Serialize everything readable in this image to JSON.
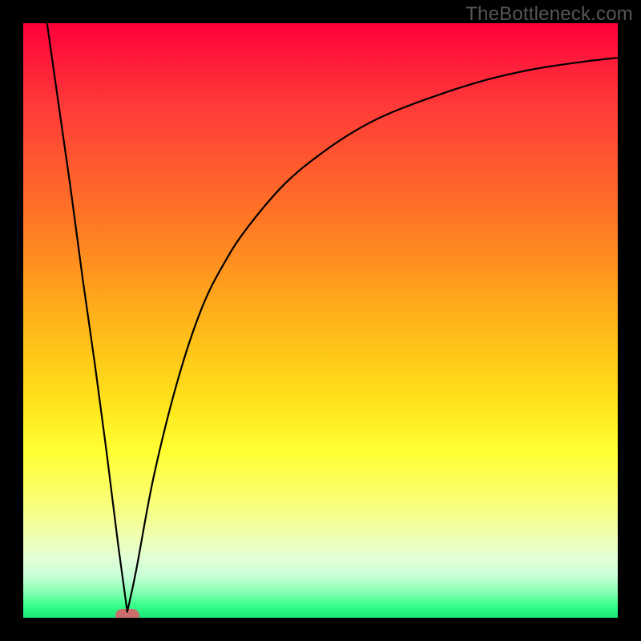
{
  "watermark": "TheBottleneck.com",
  "colors": {
    "frame": "#000000",
    "pill": "#cb6f6d",
    "curve": "#000000"
  },
  "chart_data": {
    "type": "line",
    "title": "",
    "xlabel": "",
    "ylabel": "",
    "xlim": [
      0,
      100
    ],
    "ylim": [
      0,
      100
    ],
    "grid": false,
    "legend": false,
    "annotations": [
      {
        "name": "marker-pill",
        "x": 17.5,
        "y": 0,
        "color": "#cb6f6d"
      }
    ],
    "series": [
      {
        "name": "bottleneck-curve",
        "x": [
          4,
          6,
          8,
          10,
          12,
          14,
          16,
          17.5,
          19,
          22,
          26,
          30,
          34,
          38,
          44,
          50,
          56,
          62,
          70,
          78,
          86,
          94,
          100
        ],
        "y": [
          100,
          86,
          72,
          57,
          43,
          28,
          12,
          1,
          8,
          24,
          40,
          52,
          60,
          66,
          73,
          78,
          82,
          85,
          88,
          90.5,
          92.3,
          93.5,
          94.2
        ]
      }
    ]
  }
}
